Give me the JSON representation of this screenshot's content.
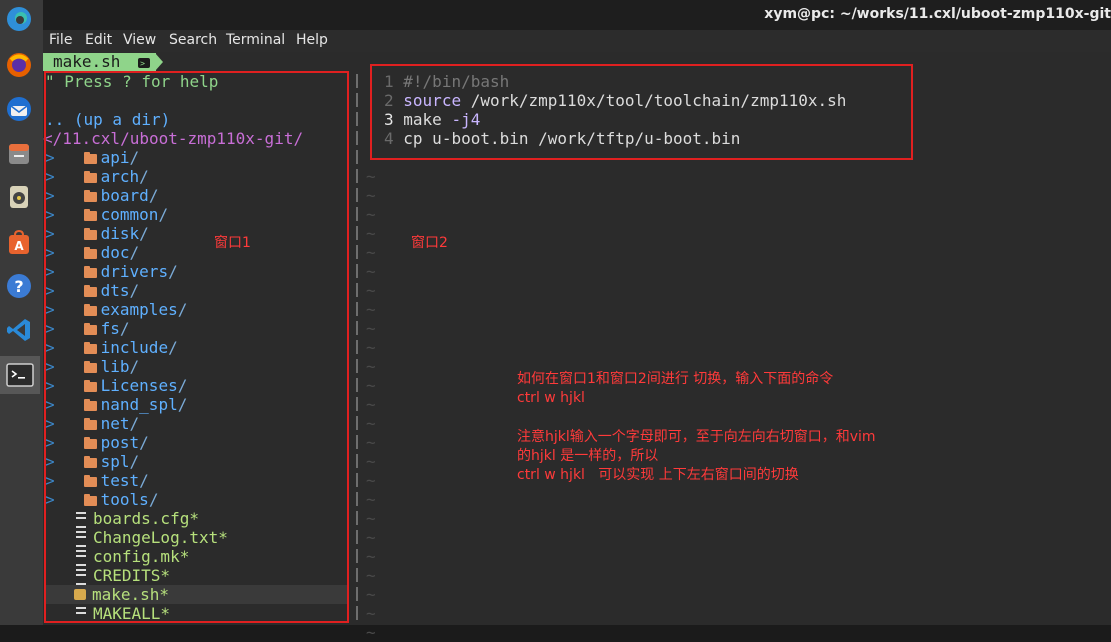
{
  "window": {
    "title": "xym@pc: ~/works/11.cxl/uboot-zmp110x-git"
  },
  "menu": [
    "File",
    "Edit",
    "View",
    "Search",
    "Terminal",
    "Help"
  ],
  "tab": {
    "label": "make.sh"
  },
  "tree": {
    "help": "\" Press ? for help",
    "up": ".. (up a dir)",
    "path": "</11.cxl/uboot-zmp110x-git/",
    "dirs": [
      "api",
      "arch",
      "board",
      "common",
      "disk",
      "doc",
      "drivers",
      "dts",
      "examples",
      "fs",
      "include",
      "lib",
      "Licenses",
      "nand_spl",
      "net",
      "post",
      "spl",
      "test",
      "tools"
    ],
    "files": [
      "boards.cfg*",
      "ChangeLog.txt*",
      "config.mk*",
      "CREDITS*",
      "make.sh*",
      "MAKEALL*"
    ]
  },
  "editor": {
    "lines": [
      {
        "num": "1",
        "text": "#!/bin/bash"
      },
      {
        "num": "2",
        "keyword": "source",
        "text": " /work/zmp110x/tool/toolchain/zmp110x.sh"
      },
      {
        "num": "3",
        "keyword": "make",
        "flag": " -j4"
      },
      {
        "num": "4",
        "text": "cp u-boot.bin /work/tftp/u-boot.bin"
      }
    ],
    "tilde": "~"
  },
  "annotations": {
    "window1": "窗口1",
    "window2": "窗口2",
    "note_line1": "如何在窗口1和窗口2间进行 切换，输入下面的命令",
    "note_line2": "ctrl w hjkl",
    "note_line3": "注意hjkl输入一个字母即可，至于向左向右切窗口，和vim",
    "note_line4": "的hjkl 是一样的，所以",
    "note_line5": "ctrl w hjkl   可以实现 上下左右窗口间的切换"
  },
  "colors": {
    "tab_bg": "#8fd48a",
    "annotation": "#e02020",
    "directory": "#5fb0ff",
    "file": "#b6e07c",
    "keyword": "#c9b6ff",
    "comment": "#777777"
  }
}
